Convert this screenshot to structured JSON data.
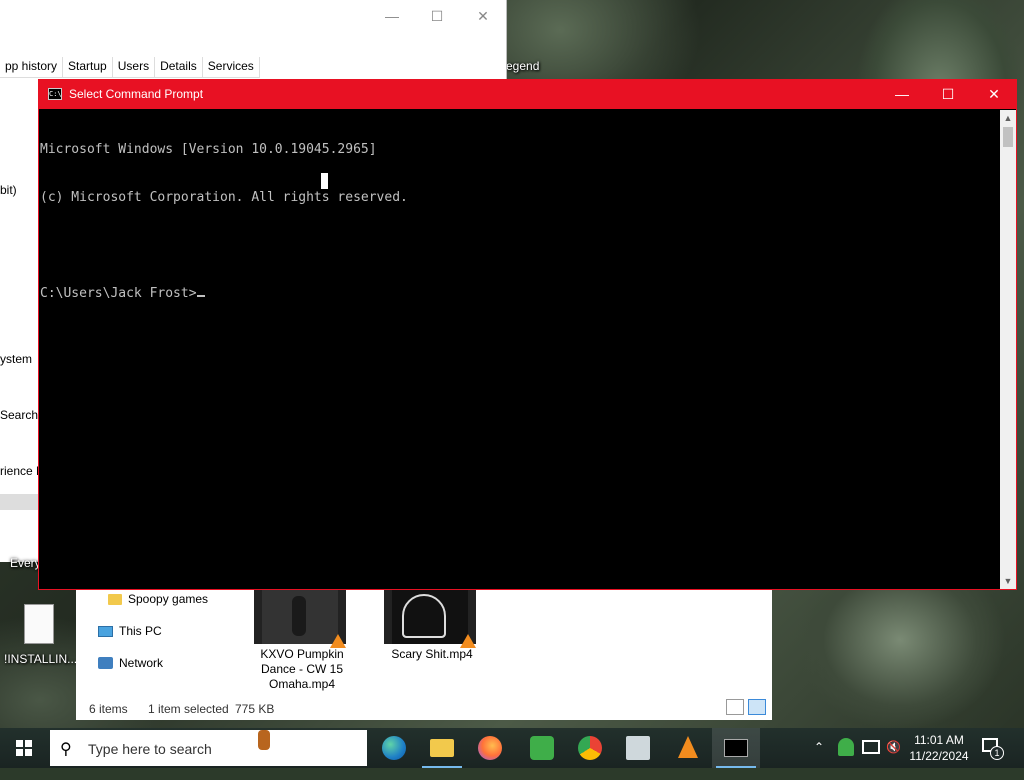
{
  "desktop": {
    "labels": {
      "legend": "egend",
      "installer": "!INSTALLIN...",
      "every": "Every"
    }
  },
  "task_manager": {
    "tabs": [
      "pp history",
      "Startup",
      "Users",
      "Details",
      "Services"
    ],
    "side_items": [
      "bit)",
      "ystem",
      "Search",
      "rience H"
    ]
  },
  "cmd": {
    "title": "Select Command Prompt",
    "lines": [
      "Microsoft Windows [Version 10.0.19045.2965]",
      "(c) Microsoft Corporation. All rights reserved.",
      "",
      "C:\\Users\\Jack Frost>"
    ],
    "border_color": "#e81123",
    "text_color": "#c0c0c0"
  },
  "explorer": {
    "nav": [
      "Spoopy games",
      "This PC",
      "Network"
    ],
    "files": [
      {
        "name": "KXVO Pumpkin Dance - CW 15 Omaha.mp4"
      },
      {
        "name": "Scary Shit.mp4"
      }
    ],
    "status": {
      "items": "6 items",
      "selected": "1 item selected",
      "size": "775 KB"
    }
  },
  "taskbar": {
    "search_placeholder": "Type here to search",
    "apps": [
      "edge-icon",
      "file-explorer-icon",
      "firefox-icon",
      "game-icon",
      "chrome-icon",
      "network-tool-icon",
      "vlc-icon",
      "cmd-icon"
    ],
    "time": "11:01 AM",
    "date": "11/22/2024",
    "notification_count": "1"
  }
}
